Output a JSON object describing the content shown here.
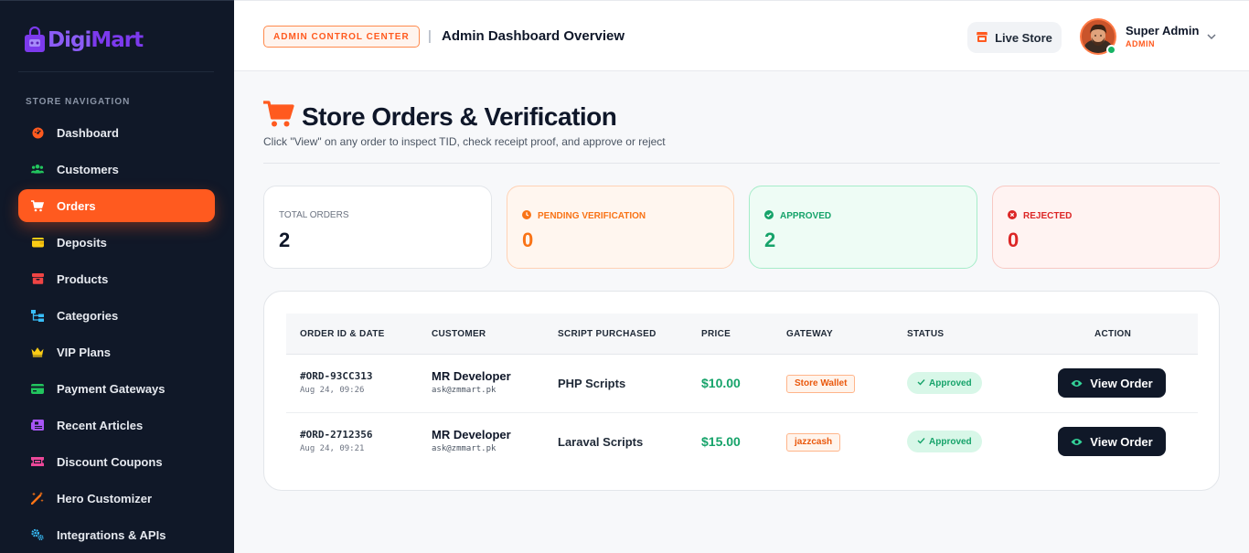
{
  "brand": {
    "name_part1": "Digi",
    "name_part2": "Mart"
  },
  "sidebar": {
    "heading": "STORE NAVIGATION",
    "items": [
      {
        "label": "Dashboard",
        "icon": "dashboard-gauge-icon",
        "color": "#ff5a1f"
      },
      {
        "label": "Customers",
        "icon": "users-icon",
        "color": "#22c55e"
      },
      {
        "label": "Orders",
        "icon": "cart-icon",
        "color": "#ffffff",
        "active": true
      },
      {
        "label": "Deposits",
        "icon": "wallet-icon",
        "color": "#facc15"
      },
      {
        "label": "Products",
        "icon": "box-icon",
        "color": "#ef4444"
      },
      {
        "label": "Categories",
        "icon": "sitemap-icon",
        "color": "#38bdf8"
      },
      {
        "label": "VIP Plans",
        "icon": "crown-icon",
        "color": "#facc15"
      },
      {
        "label": "Payment Gateways",
        "icon": "credit-card-icon",
        "color": "#22c55e"
      },
      {
        "label": "Recent Articles",
        "icon": "newspaper-icon",
        "color": "#a855f7"
      },
      {
        "label": "Discount Coupons",
        "icon": "ticket-icon",
        "color": "#ec4899"
      },
      {
        "label": "Hero Customizer",
        "icon": "magic-wand-icon",
        "color": "#f97316"
      },
      {
        "label": "Integrations & APIs",
        "icon": "cogs-icon",
        "color": "#38bdf8"
      }
    ]
  },
  "header": {
    "badge": "ADMIN CONTROL CENTER",
    "separator": "|",
    "title": "Admin Dashboard Overview",
    "live_store": "Live Store",
    "user_name": "Super Admin",
    "user_role": "ADMIN"
  },
  "page": {
    "title": "Store Orders & Verification",
    "subtitle": "Click \"View\" on any order to inspect TID, check receipt proof, and approve or reject"
  },
  "stats": {
    "total": {
      "label": "TOTAL ORDERS",
      "value": "2"
    },
    "pending": {
      "label": "PENDING VERIFICATION",
      "value": "0"
    },
    "approved": {
      "label": "APPROVED",
      "value": "2"
    },
    "rejected": {
      "label": "REJECTED",
      "value": "0"
    }
  },
  "table": {
    "columns": [
      "ORDER ID & DATE",
      "CUSTOMER",
      "SCRIPT PURCHASED",
      "PRICE",
      "GATEWAY",
      "STATUS",
      "ACTION"
    ],
    "rows": [
      {
        "order_id": "#ORD-93CC313",
        "date": "Aug 24, 09:26",
        "customer": "MR Developer",
        "email": "ask@zmmart.pk",
        "script": "PHP Scripts",
        "price": "$10.00",
        "gateway": "Store Wallet",
        "status": "Approved",
        "action": "View Order"
      },
      {
        "order_id": "#ORD-2712356",
        "date": "Aug 24, 09:21",
        "customer": "MR Developer",
        "email": "ask@zmmart.pk",
        "script": "Laraval Scripts",
        "price": "$15.00",
        "gateway": "jazzcash",
        "status": "Approved",
        "action": "View Order"
      }
    ]
  },
  "colors": {
    "accent": "#ff5a1f",
    "sidebar_bg": "#101828",
    "success": "#16a36a",
    "danger": "#dc2626",
    "warning": "#f97316"
  }
}
